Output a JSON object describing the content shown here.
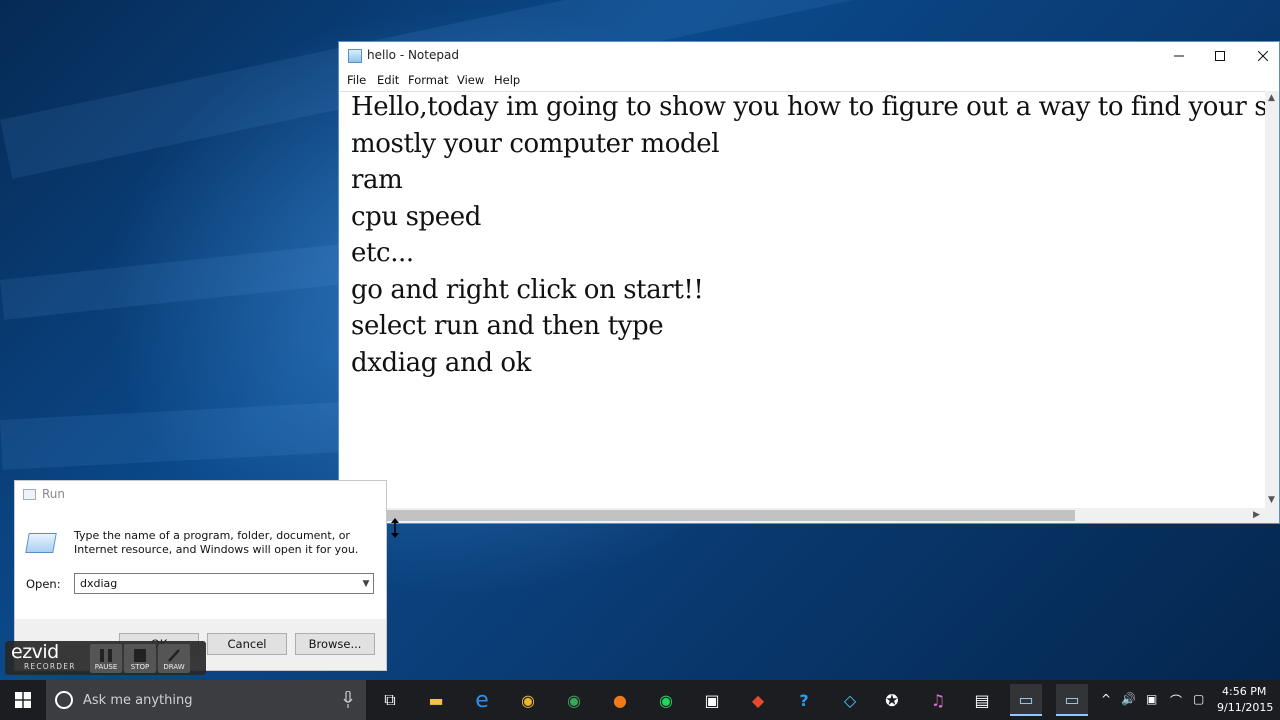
{
  "notepad": {
    "title": "hello - Notepad",
    "menu": [
      "File",
      "Edit",
      "Format",
      "View",
      "Help"
    ],
    "lines": [
      "Hello,today im going to show you how to figure out a way to find your sy",
      "mostly your computer model",
      "ram",
      "cpu speed",
      "etc...",
      "go and right click on start!!",
      "select run and then type",
      "dxdiag and ok"
    ]
  },
  "run_dialog": {
    "title": "Run",
    "description": "Type the name of a program, folder, document, or Internet resource, and Windows will open it for you.",
    "open_label": "Open:",
    "input_value": "dxdiag",
    "buttons": {
      "ok": "OK",
      "cancel": "Cancel",
      "browse": "Browse..."
    }
  },
  "ezvid": {
    "logo": "ezvid",
    "sublabel": "RECORDER",
    "buttons": [
      "PAUSE",
      "STOP",
      "DRAW"
    ]
  },
  "taskbar": {
    "search_placeholder": "Ask me anything",
    "apps": [
      {
        "name": "task-view",
        "glyph": "⧉"
      },
      {
        "name": "file-explorer",
        "glyph": "▬"
      },
      {
        "name": "edge",
        "glyph": "e"
      },
      {
        "name": "chrome",
        "glyph": "◉"
      },
      {
        "name": "chrome-alt",
        "glyph": "◉"
      },
      {
        "name": "firefox",
        "glyph": "●"
      },
      {
        "name": "spotify",
        "glyph": "◉"
      },
      {
        "name": "store",
        "glyph": "▣"
      },
      {
        "name": "app-red",
        "glyph": "◆"
      },
      {
        "name": "help",
        "glyph": "?"
      },
      {
        "name": "app-diamond",
        "glyph": "◇"
      },
      {
        "name": "app-settings",
        "glyph": "✪"
      },
      {
        "name": "itunes",
        "glyph": "♫"
      },
      {
        "name": "clapper",
        "glyph": "▤"
      },
      {
        "name": "notepad",
        "glyph": "▭"
      },
      {
        "name": "run",
        "glyph": "▭"
      }
    ],
    "tray_icons": [
      "^",
      "🔊",
      "▣",
      "⌒",
      "▢"
    ],
    "time": "4:56 PM",
    "date": "9/11/2015"
  }
}
